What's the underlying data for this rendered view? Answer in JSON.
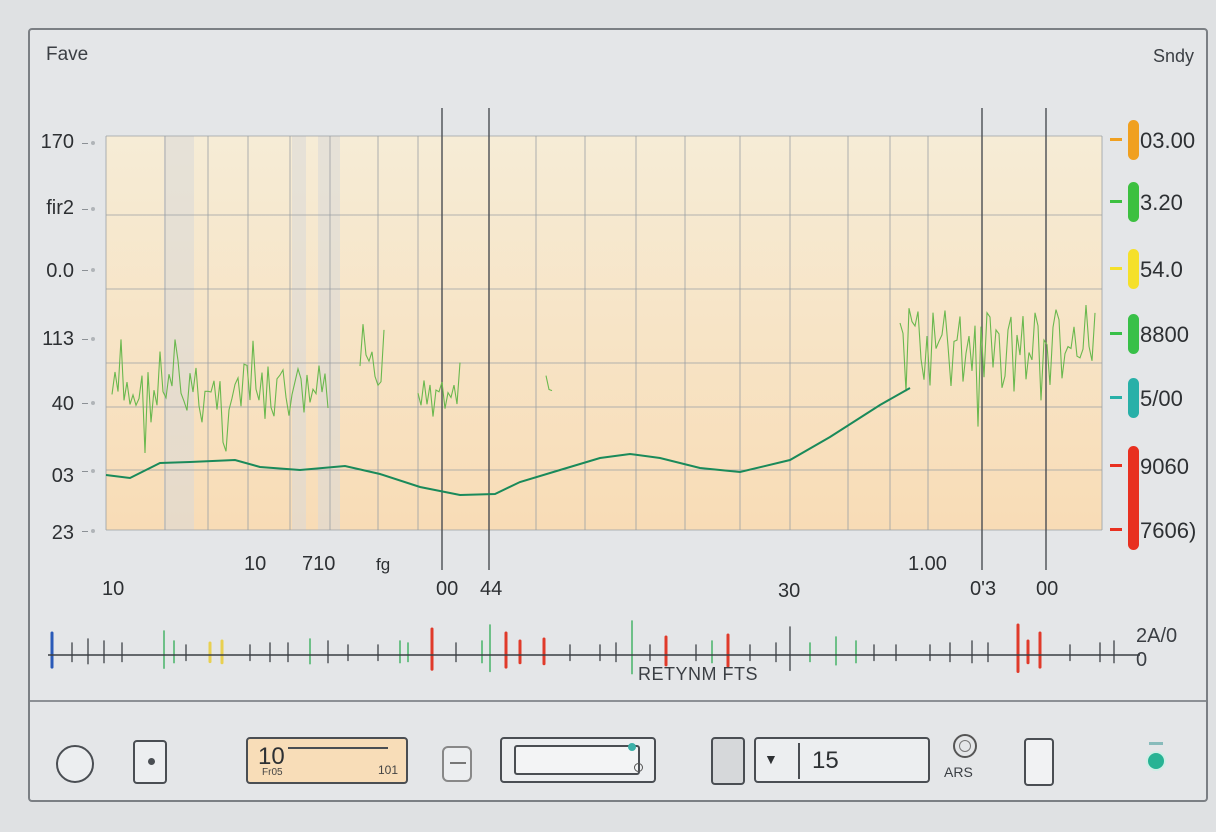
{
  "header": {
    "left_title": "Fave",
    "right_title": "Sndy"
  },
  "y_axis_labels": [
    "170",
    "fir2",
    "0.0",
    "113",
    "40",
    "03",
    "23"
  ],
  "x_axis_labels": [
    "10",
    "10",
    "710",
    "fg",
    "00",
    "44",
    "30",
    "1.00",
    "0'3",
    "00"
  ],
  "right_readings": [
    {
      "value": "03.00",
      "color": "#f0a020"
    },
    {
      "value": "3.20",
      "color": "#3cc040"
    },
    {
      "value": "54.0",
      "color": "#f5e02a"
    },
    {
      "value": "8800",
      "color": "#38c048"
    },
    {
      "value": "5/00",
      "color": "#28b0a8"
    },
    {
      "value": "9060",
      "color": "#e83020"
    },
    {
      "value": "7606)",
      "color": "#e83020"
    }
  ],
  "rhythm_strip": {
    "label": "RETYNM FTS",
    "right_top": "2A/0",
    "right_bottom": "0"
  },
  "controls": {
    "display_value": "10",
    "display_sub": "Fr05",
    "display_right": "101",
    "select_value": "15",
    "ring_label": "ARS"
  },
  "colors": {
    "plot_bg_top": "#f6ecd8",
    "plot_bg_bottom": "#f8ddb8",
    "trend_line": "#1a8a5a",
    "noise_line": "#6ab84e",
    "rhythm_red": "#e03a2a",
    "rhythm_green": "#3cb060",
    "rhythm_blue": "#2a5ab8"
  }
}
